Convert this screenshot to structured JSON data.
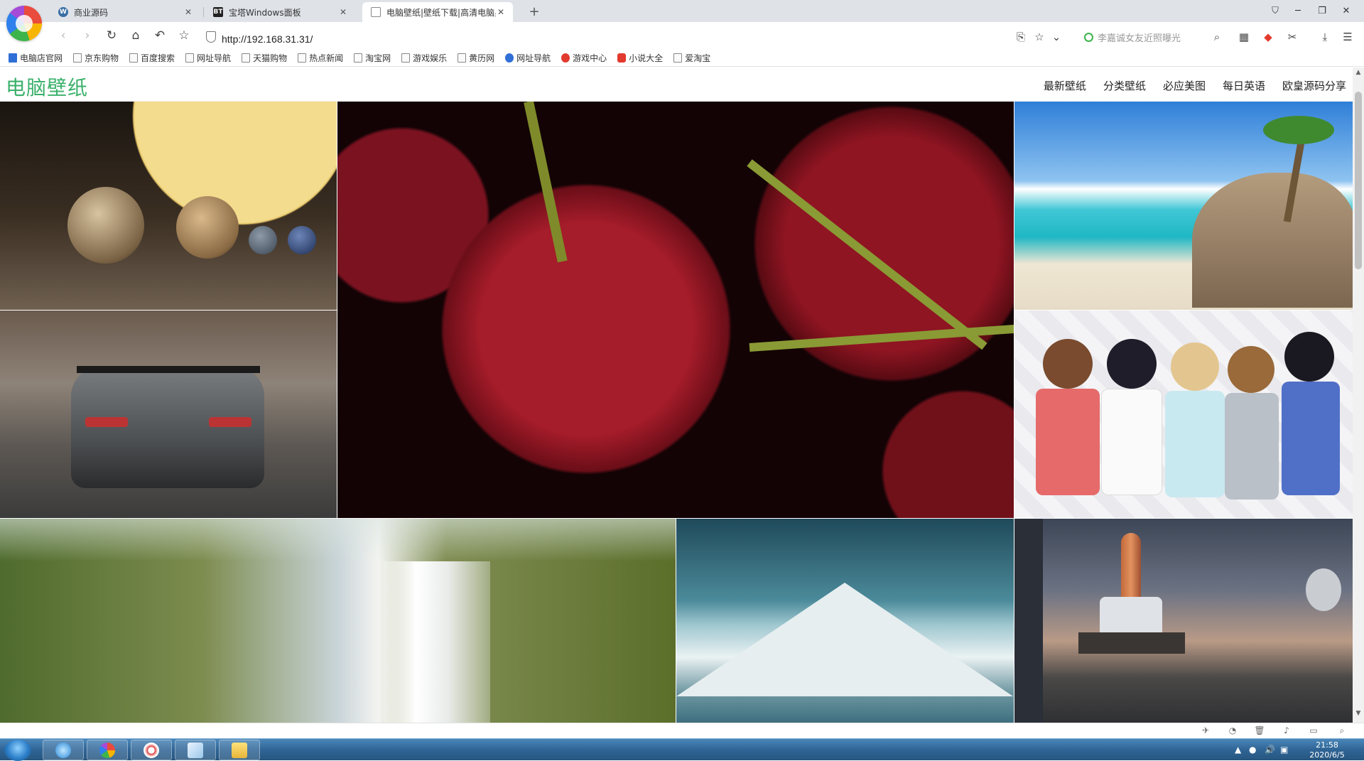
{
  "browser": {
    "tabs": [
      {
        "title": "商业源码",
        "favicon": "wordpress-icon"
      },
      {
        "title": "宝塔Windows面板",
        "favicon": "bt-icon",
        "favicon_text": "BT"
      },
      {
        "title": "电脑壁纸|壁纸下载|高清电脑桌面壁纸",
        "favicon": "page-icon"
      }
    ],
    "url": "http://192.168.31.31/",
    "search_placeholder": "李嘉诚女友近照曝光",
    "bookmarks": [
      "电脑店官网",
      "京东购物",
      "百度搜索",
      "网址导航",
      "天猫购物",
      "热点新闻",
      "淘宝网",
      "游戏娱乐",
      "黄历网",
      "网址导航",
      "游戏中心",
      "小说大全",
      "爱淘宝"
    ]
  },
  "site": {
    "logo": "电脑壁纸",
    "nav": [
      "最新壁纸",
      "分类壁纸",
      "必应美图",
      "每日英语",
      "欧皇源码分享"
    ]
  },
  "taskbar": {
    "time": "21:58",
    "date": "2020/6/5"
  },
  "colors": {
    "brand_green": "#3bb16b",
    "taskbar_blue": "#2f6596"
  }
}
